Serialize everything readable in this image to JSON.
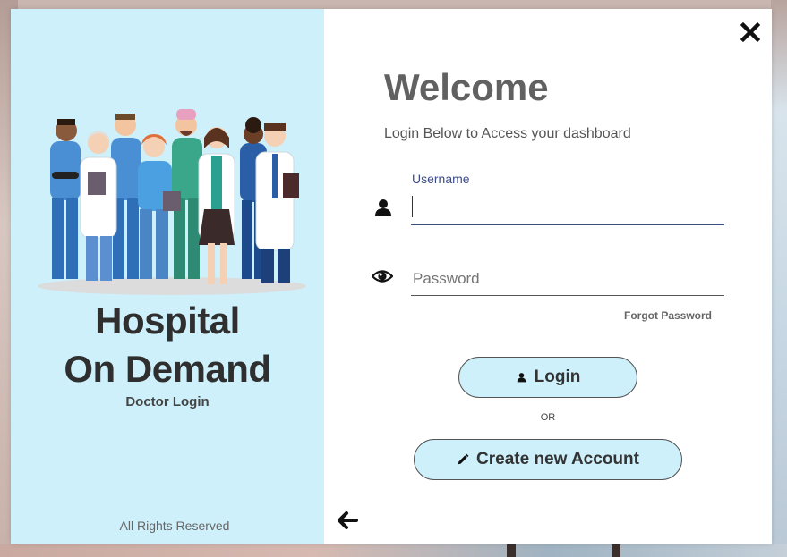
{
  "brand": {
    "title_line1": "Hospital",
    "title_line2": "On Demand",
    "subtitle": "Doctor Login",
    "footer": "All Rights Reserved"
  },
  "login": {
    "heading": "Welcome",
    "tagline": "Login Below to Access your dashboard",
    "username_label": "Username",
    "username_value": "",
    "password_placeholder": "Password",
    "forgot_password": "Forgot Password",
    "login_button": "Login",
    "separator": "OR",
    "create_account_button": "Create new Account"
  },
  "icons": {
    "close": "close-icon",
    "back": "arrow-left-icon",
    "username": "user-icon",
    "password": "eye-icon",
    "login": "user-icon",
    "create": "pencil-icon"
  },
  "colors": {
    "panel": "#cdf0fb",
    "button_fill": "#cdf0fb",
    "username_underline": "#3f4f7f",
    "label_blue": "#3c4b8a"
  }
}
